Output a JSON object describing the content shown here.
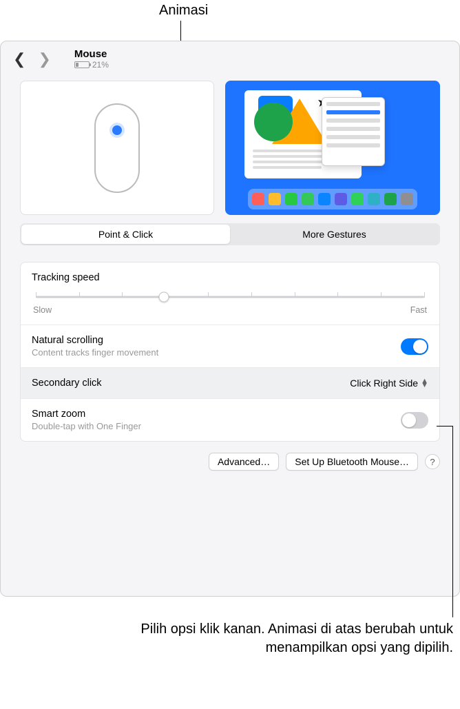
{
  "callouts": {
    "top": "Animasi",
    "bottom": "Pilih opsi klik kanan. Animasi di atas berubah untuk menampilkan opsi yang dipilih."
  },
  "header": {
    "title": "Mouse",
    "battery_pct": "21%"
  },
  "tabs": {
    "point_click": "Point & Click",
    "more_gestures": "More Gestures"
  },
  "settings": {
    "tracking": {
      "label": "Tracking speed",
      "slow": "Slow",
      "fast": "Fast",
      "value_pct": 33
    },
    "natural_scrolling": {
      "label": "Natural scrolling",
      "sub": "Content tracks finger movement",
      "on": true
    },
    "secondary_click": {
      "label": "Secondary click",
      "value": "Click Right Side"
    },
    "smart_zoom": {
      "label": "Smart zoom",
      "sub": "Double-tap with One Finger",
      "on": false
    }
  },
  "footer": {
    "advanced": "Advanced…",
    "setup_bt": "Set Up Bluetooth Mouse…",
    "help": "?"
  },
  "dock_colors": [
    "#ff5f57",
    "#ffbd2e",
    "#28c840",
    "#28c840",
    "#0a84ff",
    "#0a7cff",
    "#5e5ce6",
    "#30d158",
    "#30b0c7",
    "#8e8e93"
  ]
}
